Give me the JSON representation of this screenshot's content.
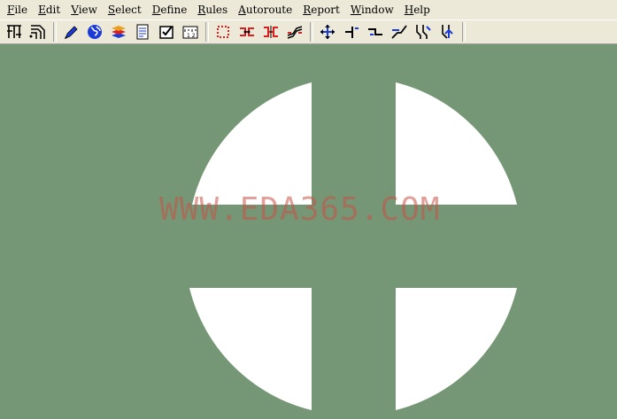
{
  "menu": {
    "items": [
      {
        "acc": "F",
        "rest": "ile"
      },
      {
        "acc": "E",
        "rest": "dit"
      },
      {
        "acc": "V",
        "rest": "iew"
      },
      {
        "acc": "S",
        "rest": "elect"
      },
      {
        "acc": "D",
        "rest": "efine"
      },
      {
        "acc": "R",
        "rest": "ules"
      },
      {
        "acc": "A",
        "rest": "utoroute"
      },
      {
        "acc": "R",
        "rest": "eport"
      },
      {
        "acc": "W",
        "rest": "indow"
      },
      {
        "acc": "H",
        "rest": "elp"
      }
    ]
  },
  "toolbar": {
    "icons": [
      "route-tree-icon",
      "fanout-icon",
      "pen-icon",
      "globe-icon",
      "layers-icon",
      "report-icon",
      "checkbox-icon",
      "measure-icon",
      "select-chip-icon",
      "net-icon",
      "nets-icon",
      "diff-pair-icon",
      "move-icon",
      "corner-icon",
      "push-icon",
      "smooth-icon",
      "miter-icon",
      "autoroute-icon"
    ]
  },
  "canvas": {
    "background": "#759775",
    "pad_color": "#ffffff",
    "watermark": "WWW.EDA365.COM"
  }
}
